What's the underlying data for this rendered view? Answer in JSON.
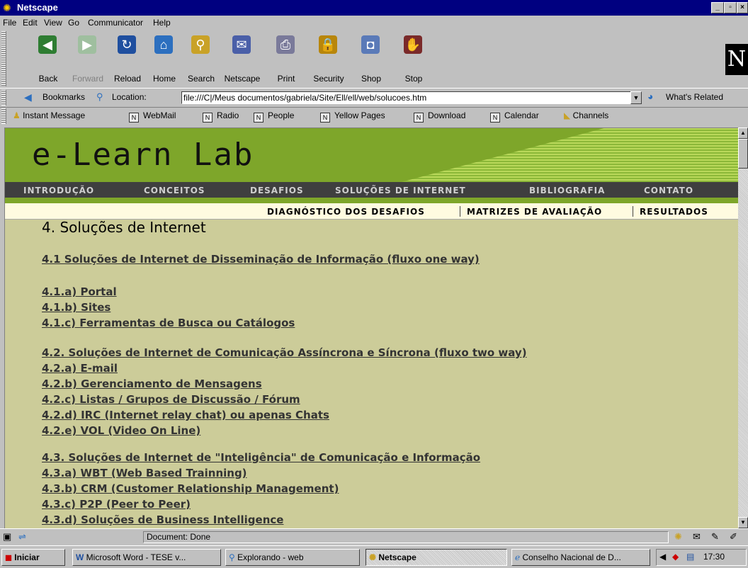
{
  "window": {
    "title": "Netscape",
    "minimize": "_",
    "restore": "▫",
    "close": "×"
  },
  "menu": [
    "File",
    "Edit",
    "View",
    "Go",
    "Communicator",
    "Help"
  ],
  "toolbar": {
    "back": "Back",
    "forward": "Forward",
    "reload": "Reload",
    "home": "Home",
    "search": "Search",
    "netscape": "Netscape",
    "print": "Print",
    "security": "Security",
    "shop": "Shop",
    "stop": "Stop"
  },
  "location": {
    "bookmarks": "Bookmarks",
    "label": "Location:",
    "url": "file:///C|/Meus documentos/gabriela/Site/Ell/ell/web/solucoes.htm",
    "related": "What's Related"
  },
  "personal": [
    "Instant Message",
    "WebMail",
    "Radio",
    "People",
    "Yellow Pages",
    "Download",
    "Calendar",
    "Channels"
  ],
  "site": {
    "logo": "e-Learn Lab",
    "nav": [
      "INTRODUÇÃO",
      "CONCEITOS",
      "DESAFIOS",
      "SOLUÇÕES DE INTERNET",
      "BIBLIOGRAFIA",
      "CONTATO"
    ],
    "subnav": [
      "DIAGNÓSTICO DOS DESAFIOS",
      "MATRIZES DE AVALIAÇÃO",
      "RESULTADOS"
    ],
    "title": "4. Soluções de Internet",
    "links": [
      "4.1 Soluções de Internet de Disseminação de Informação (fluxo one way)",
      "4.1.a) Portal",
      "4.1.b) Sites",
      "4.1.c) Ferramentas de Busca ou Catálogos",
      "4.2. Soluções de Internet de Comunicação Assíncrona e Síncrona (fluxo two way)",
      "4.2.a) E-mail",
      "4.2.b) Gerenciamento de Mensagens",
      "4.2.c) Listas / Grupos de Discussão / Fórum",
      "4.2.d) IRC (Internet relay chat) ou apenas Chats",
      "4.2.e) VOL (Video On Line)",
      "4.3. Soluções de Internet de \"Inteligência\" de Comunicação e Informação",
      "4.3.a) WBT (Web Based Trainning)",
      "4.3.b) CRM (Customer Relationship Management)",
      "4.3.c) P2P (Peer to Peer)",
      "4.3.d) Soluções de Business Intelligence"
    ]
  },
  "status": {
    "text": "Document: Done"
  },
  "taskbar": {
    "start": "Iniciar",
    "tasks": [
      "Microsoft Word - TESE v...",
      "Explorando - web",
      "Netscape",
      "Conselho Nacional de D..."
    ],
    "clock": "17:30"
  },
  "colors": {
    "titlebar": "#000080",
    "content_bg": "#cccc99",
    "banner": "#7ea62a"
  }
}
